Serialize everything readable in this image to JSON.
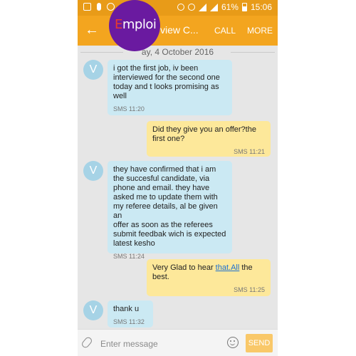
{
  "status_bar": {
    "battery_text": "61%",
    "time": "15:06"
  },
  "header": {
    "title": "Interview C...",
    "title_visible": "view C...",
    "call_label": "CALL",
    "more_label": "MORE",
    "back_icon": "back-arrow-icon"
  },
  "brand": {
    "logo_text": "Emploi",
    "logo_e": "E",
    "logo_rest": "mploi"
  },
  "date_separator": "Tuesday, 4 October 2016",
  "date_visible": "ay, 4 October 2016",
  "messages": [
    {
      "direction": "incoming",
      "avatar": "V",
      "text": "i got the first  job, iv been\ninterviewed for the second one\ntoday and t looks promising as\nwell",
      "meta": "SMS 11:20"
    },
    {
      "direction": "outgoing",
      "text": " Did they give you an offer?the\nfirst one?",
      "meta": "SMS 11:21"
    },
    {
      "direction": "incoming",
      "avatar": "V",
      "text": "they have confirmed that i am\nthe succesful candidate, via\nphone and email. they have\nasked me to update them with\nmy referee details, al be given an\noffer as soon as the referees\nsubmit feedbak wich is expected\nlatest kesho",
      "meta": "SMS 11:24"
    },
    {
      "direction": "outgoing",
      "text_before": "Very Glad to hear ",
      "link_text": "that.All",
      "text_after": " the\nbest.",
      "meta": "SMS 11:25"
    },
    {
      "direction": "incoming",
      "avatar": "V",
      "text": "thank u",
      "meta": "SMS 11:32"
    }
  ],
  "input": {
    "placeholder": "Enter message",
    "send_label": "SEND",
    "attach_icon": "paperclip-icon",
    "emoji_icon": "emoji-icon"
  },
  "colors": {
    "header": "#f3a51f",
    "status_bar": "#e89b18",
    "incoming_bubble": "#cbe9f3",
    "outgoing_bubble": "#fde89a",
    "brand": "#6a1aa0"
  }
}
